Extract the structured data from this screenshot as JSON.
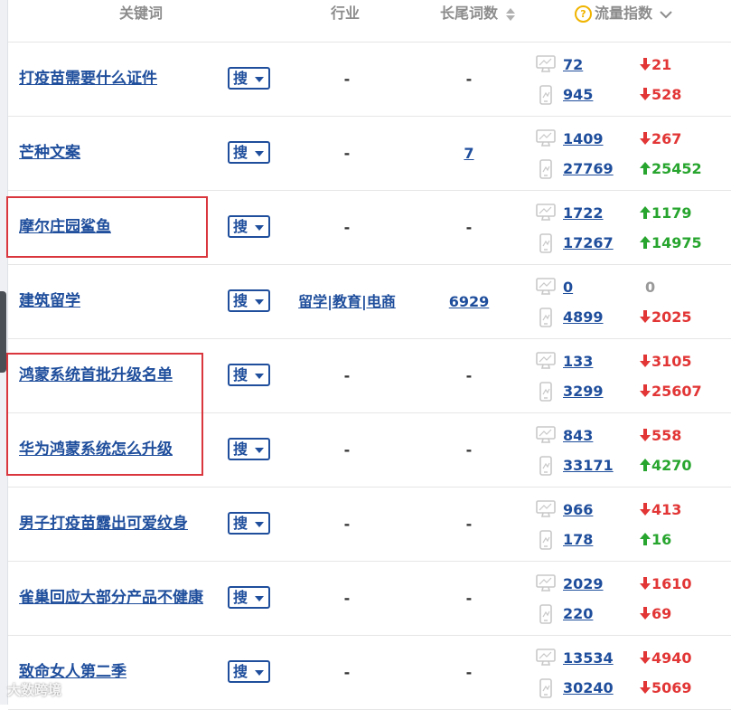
{
  "header": {
    "keyword": "关键词",
    "industry": "行业",
    "longtail": "长尾词数",
    "flow": "流量指数"
  },
  "search_button_label": "搜",
  "rows": [
    {
      "keyword": "打疫苗需要什么证件",
      "industry": "-",
      "longtail": "-",
      "pc": "72",
      "pc_change": "21",
      "pc_dir": "down",
      "mobile": "945",
      "mobile_change": "528",
      "mobile_dir": "down"
    },
    {
      "keyword": "芒种文案",
      "industry": "-",
      "longtail": "7",
      "pc": "1409",
      "pc_change": "267",
      "pc_dir": "down",
      "mobile": "27769",
      "mobile_change": "25452",
      "mobile_dir": "up"
    },
    {
      "keyword": "摩尔庄园鲨鱼",
      "industry": "-",
      "longtail": "-",
      "pc": "1722",
      "pc_change": "1179",
      "pc_dir": "up",
      "mobile": "17267",
      "mobile_change": "14975",
      "mobile_dir": "up"
    },
    {
      "keyword": "建筑留学",
      "industry": "留学|教育|电商",
      "longtail": "6929",
      "pc": "0",
      "pc_change": "0",
      "pc_dir": "none",
      "mobile": "4899",
      "mobile_change": "2025",
      "mobile_dir": "down"
    },
    {
      "keyword": "鸿蒙系统首批升级名单",
      "industry": "-",
      "longtail": "-",
      "pc": "133",
      "pc_change": "3105",
      "pc_dir": "down",
      "mobile": "3299",
      "mobile_change": "25607",
      "mobile_dir": "down"
    },
    {
      "keyword": "华为鸿蒙系统怎么升级",
      "industry": "-",
      "longtail": "-",
      "pc": "843",
      "pc_change": "558",
      "pc_dir": "down",
      "mobile": "33171",
      "mobile_change": "4270",
      "mobile_dir": "up"
    },
    {
      "keyword": "男子打疫苗露出可爱纹身",
      "industry": "-",
      "longtail": "-",
      "pc": "966",
      "pc_change": "413",
      "pc_dir": "down",
      "mobile": "178",
      "mobile_change": "16",
      "mobile_dir": "up"
    },
    {
      "keyword": "雀巢回应大部分产品不健康",
      "industry": "-",
      "longtail": "-",
      "pc": "2029",
      "pc_change": "1610",
      "pc_dir": "down",
      "mobile": "220",
      "mobile_change": "69",
      "mobile_dir": "down"
    },
    {
      "keyword": "致命女人第二季",
      "industry": "-",
      "longtail": "-",
      "pc": "13534",
      "pc_change": "4940",
      "pc_dir": "down",
      "mobile": "30240",
      "mobile_change": "5069",
      "mobile_dir": "down"
    }
  ],
  "icons": {
    "pc": "monitor-icon",
    "mobile": "phone-icon",
    "up": "arrow-up-icon",
    "down": "arrow-down-icon"
  },
  "colors": {
    "link": "#1f4e9c",
    "up": "#27a52e",
    "down": "#e23535",
    "highlight": "#d9363e"
  },
  "watermark": "大数跨境"
}
